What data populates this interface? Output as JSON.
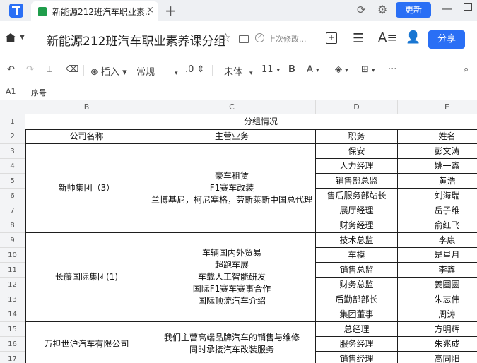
{
  "tabbar": {
    "tab_title": "新能源212班汽车职业素...",
    "close_glyph": "×",
    "add_glyph": "+",
    "update_label": "更新"
  },
  "titlebar": {
    "doc_title": "新能源212班汽车职业素养课分组",
    "saved_status": "上次修改...",
    "share_label": "分享"
  },
  "toolbar": {
    "insert_label": "插入",
    "number_format": "常规",
    "decimal": ".0",
    "font_name": "宋体",
    "font_size": "11",
    "bold": "B",
    "font_color_letter": "A",
    "more": "···"
  },
  "formula_bar": {
    "cell_ref": "A1",
    "content": "序号"
  },
  "columns": [
    "B",
    "C",
    "D",
    "E"
  ],
  "rows": [
    "1",
    "2",
    "3",
    "4",
    "5",
    "6",
    "7",
    "8",
    "9",
    "10",
    "11",
    "12",
    "13",
    "14",
    "15",
    "16",
    "17"
  ],
  "sheet": {
    "group_title": "分组情况",
    "headers": {
      "company": "公司名称",
      "business": "主营业务",
      "role": "职务",
      "name": "姓名"
    },
    "groups": [
      {
        "company": "新帅集团（3）",
        "business": "豪车租赁\nF1赛车改装\n兰博基尼，柯尼塞格，劳斯莱斯中国总代理",
        "members": [
          {
            "role": "保安",
            "name": "彭文涛"
          },
          {
            "role": "人力经理",
            "name": "姚一鑫"
          },
          {
            "role": "销售部总监",
            "name": "黄浩"
          },
          {
            "role": "售后服务部站长",
            "name": "刘海瑞"
          },
          {
            "role": "展厅经理",
            "name": "岳子维"
          },
          {
            "role": "财务经理",
            "name": "俞红飞"
          }
        ]
      },
      {
        "company": "长藤国际集团(1)",
        "business": "车辆国内外贸易\n超跑车展\n车载人工智能研发\n国际F1赛车赛事合作\n国际顶流汽车介绍",
        "members": [
          {
            "role": "技术总监",
            "name": "李康"
          },
          {
            "role": "车模",
            "name": "是星月"
          },
          {
            "role": "销售总监",
            "name": "李鑫"
          },
          {
            "role": "财务总监",
            "name": "姜圆圆"
          },
          {
            "role": "后勤部部长",
            "name": "朱志伟"
          },
          {
            "role": "集团董事",
            "name": "周涛"
          }
        ]
      },
      {
        "company": "万担世沪汽车有限公司",
        "business": "我们主营高端品牌汽车的销售与维修\n同时承接汽车改装服务",
        "members": [
          {
            "role": "总经理",
            "name": "方明辉"
          },
          {
            "role": "服务经理",
            "name": "朱兆成"
          },
          {
            "role": "销售经理",
            "name": "高同阳"
          }
        ]
      }
    ]
  }
}
